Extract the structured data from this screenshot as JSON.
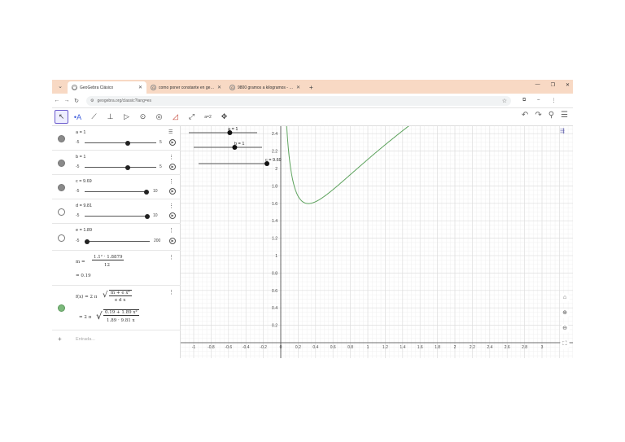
{
  "browser": {
    "tabs": [
      {
        "label": "GeoGebra Clásico",
        "active": true
      },
      {
        "label": "como poner constante en geogeb",
        "active": false
      },
      {
        "label": "9800 gramos a kilogramos - Go",
        "active": false
      }
    ],
    "new_tab": "+",
    "url": "geogebra.org/classic?lang=es"
  },
  "toolbar": {
    "tools": [
      "move-tool",
      "point-tool",
      "line-tool",
      "perpendicular-tool",
      "polygon-tool",
      "circle-tool",
      "ellipse-tool",
      "angle-tool",
      "reflect-tool",
      "slider-tool",
      "move-graphics-tool"
    ],
    "slider_tool_label": "a=2"
  },
  "algebra": {
    "sliders": [
      {
        "def": "a = 1",
        "min": "-5",
        "max": "5",
        "value": 1,
        "range": [
          -5,
          5
        ],
        "visible": true
      },
      {
        "def": "b = 1",
        "min": "-5",
        "max": "5",
        "value": 1,
        "range": [
          -5,
          5
        ],
        "visible": true
      },
      {
        "def": "c = 9.69",
        "min": "-5",
        "max": "10",
        "value": 9.69,
        "range": [
          -5,
          10
        ],
        "visible": true
      },
      {
        "def": "d = 9.81",
        "min": "-5",
        "max": "10",
        "value": 9.81,
        "range": [
          -5,
          10
        ],
        "visible": false
      },
      {
        "def": "e = 1.89",
        "min": "-5",
        "max": "200",
        "value": 1.89,
        "range": [
          -5,
          200
        ],
        "visible": false
      }
    ],
    "m": {
      "lhs": "m =",
      "num": "1.1² · 1.8879",
      "den": "12",
      "value": "= 0.19"
    },
    "f": {
      "lhs": "f(x) = 2 π",
      "rad_num": "m + e x²",
      "rad_den": "e d x",
      "eq": "= 2 π",
      "val_num": "0.19 + 1.89 x²",
      "val_den": "1.89 · 9.81 x"
    },
    "input_placeholder": "Entrada..."
  },
  "graphics": {
    "x_ticks": [
      "-1",
      "-0.8",
      "-0.6",
      "-0.4",
      "-0.2",
      "0",
      "0.2",
      "0.4",
      "0.6",
      "0.8",
      "1",
      "1.2",
      "1.4",
      "1.6",
      "1.8",
      "2",
      "2.2",
      "2.4",
      "2.6",
      "2.8",
      "3"
    ],
    "y_ticks": [
      "0.2",
      "0.4",
      "0.6",
      "0.8",
      "1",
      "1.2",
      "1.4",
      "1.6",
      "1.8",
      "2",
      "2.2",
      "2.4"
    ],
    "slider_labels": [
      "a = 1",
      "b = 1",
      "c = 9.69"
    ],
    "curve_color": "#5ea35e"
  }
}
